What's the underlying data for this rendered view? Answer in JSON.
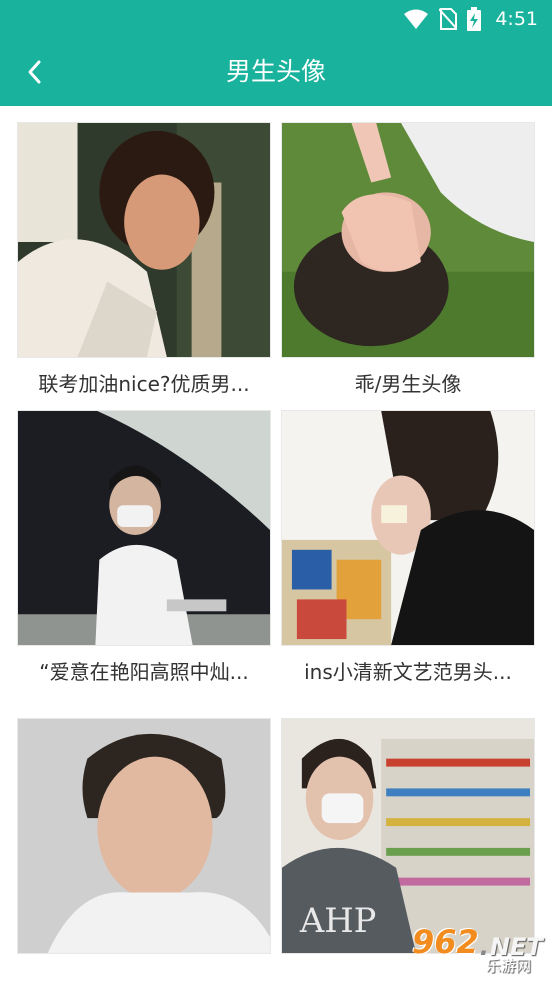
{
  "status_bar": {
    "time": "4:51"
  },
  "header": {
    "title": "男生头像"
  },
  "items": [
    {
      "caption": "联考加油nice?优质男..."
    },
    {
      "caption": "乖/男生头像"
    },
    {
      "caption": "“爱意在艳阳高照中灿..."
    },
    {
      "caption": "ins小清新文艺范男头..."
    },
    {
      "caption": ""
    },
    {
      "caption": ""
    }
  ],
  "watermark": {
    "main_num": "962",
    "main_dot": ".",
    "main_suffix": "NET",
    "sub": "乐游网"
  },
  "colors": {
    "accent": "#19b29c"
  }
}
